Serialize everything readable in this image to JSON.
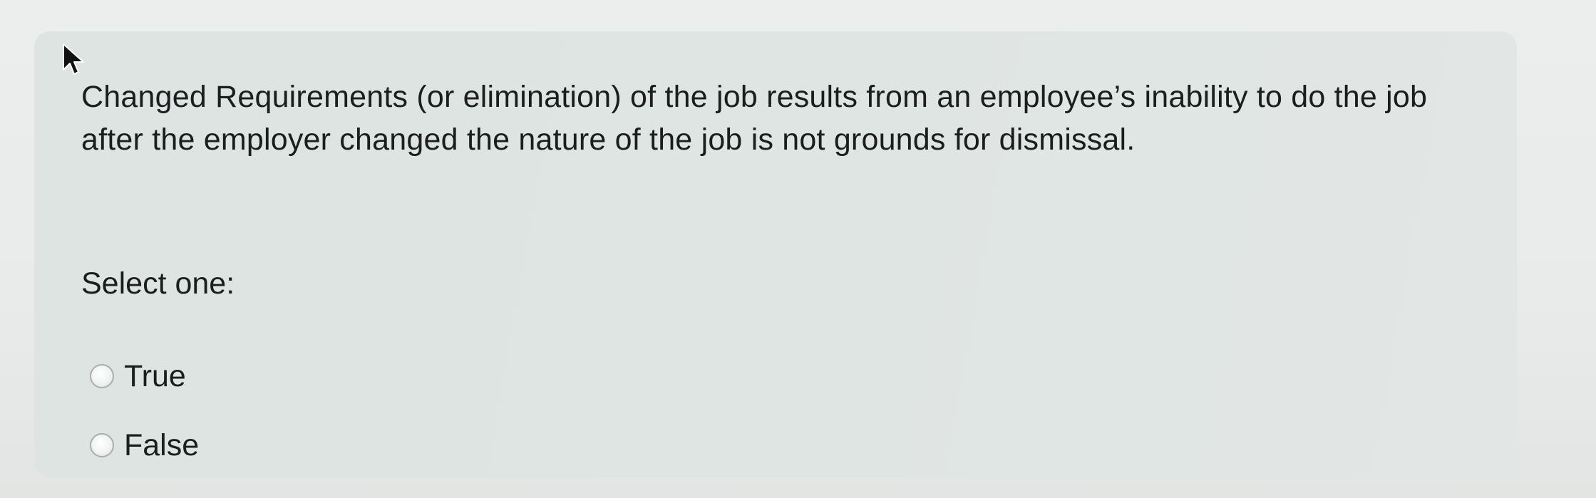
{
  "question": {
    "text": "Changed Requirements (or elimination) of the job results from an employee’s inability to do the job after the employer changed the nature of the job is not grounds for dismissal.",
    "prompt": "Select one:",
    "options": [
      {
        "label": "True",
        "selected": false
      },
      {
        "label": "False",
        "selected": false
      }
    ]
  },
  "icons": {
    "cursor": "mouse-pointer-icon"
  }
}
